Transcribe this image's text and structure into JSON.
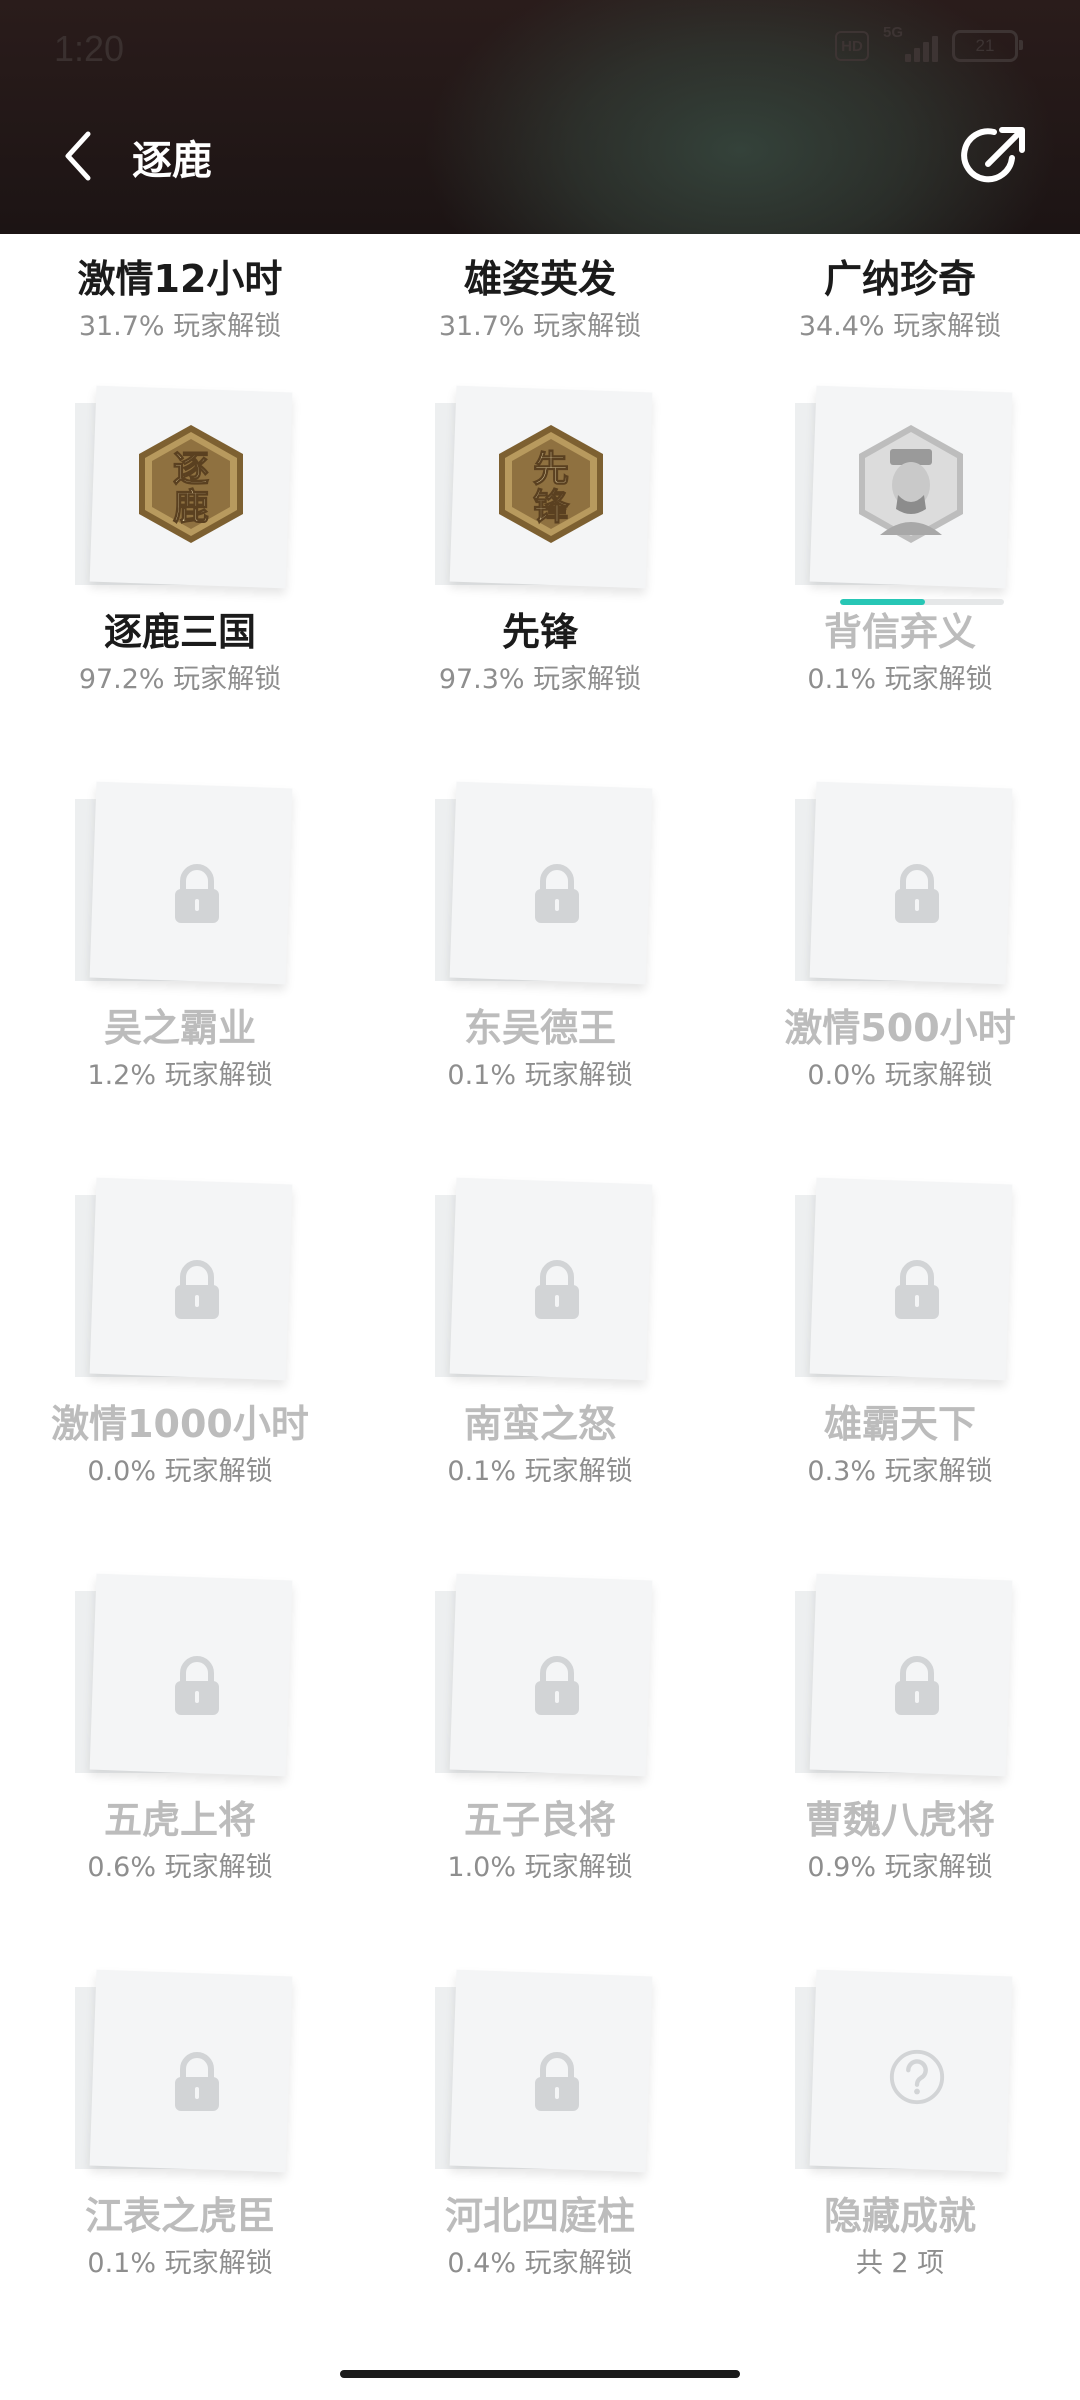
{
  "status_bar": {
    "time": "1:20",
    "network_badge": "HD",
    "network_type": "5G",
    "battery": "21"
  },
  "header": {
    "title": "逐鹿",
    "back_icon": "chevron-left-icon",
    "share_icon": "share-icon"
  },
  "colors": {
    "progress": "#27c6b5",
    "header_bg": "#1c1414",
    "locked_text": "#bcbcbc"
  },
  "achievements": [
    {
      "name": "激情12小时",
      "stat": "31.7% 玩家解锁",
      "state": "unlocked"
    },
    {
      "name": "雄姿英发",
      "stat": "31.7% 玩家解锁",
      "state": "unlocked"
    },
    {
      "name": "广纳珍奇",
      "stat": "34.4% 玩家解锁",
      "state": "unlocked"
    },
    {
      "name": "逐鹿三国",
      "stat": "97.2% 玩家解锁",
      "state": "unlocked",
      "badge": "逐鹿"
    },
    {
      "name": "先锋",
      "stat": "97.3% 玩家解锁",
      "state": "unlocked",
      "badge": "先锋"
    },
    {
      "name": "背信弃义",
      "stat": "0.1% 玩家解锁",
      "state": "in_progress",
      "progress": 0.52
    },
    {
      "name": "吴之霸业",
      "stat": "1.2% 玩家解锁",
      "state": "locked"
    },
    {
      "name": "东吴德王",
      "stat": "0.1% 玩家解锁",
      "state": "locked"
    },
    {
      "name": "激情500小时",
      "stat": "0.0% 玩家解锁",
      "state": "locked"
    },
    {
      "name": "激情1000小时",
      "stat": "0.0% 玩家解锁",
      "state": "locked"
    },
    {
      "name": "南蛮之怒",
      "stat": "0.1% 玩家解锁",
      "state": "locked"
    },
    {
      "name": "雄霸天下",
      "stat": "0.3% 玩家解锁",
      "state": "locked"
    },
    {
      "name": "五虎上将",
      "stat": "0.6% 玩家解锁",
      "state": "locked"
    },
    {
      "name": "五子良将",
      "stat": "1.0% 玩家解锁",
      "state": "locked"
    },
    {
      "name": "曹魏八虎将",
      "stat": "0.9% 玩家解锁",
      "state": "locked"
    },
    {
      "name": "江表之虎臣",
      "stat": "0.1% 玩家解锁",
      "state": "locked"
    },
    {
      "name": "河北四庭柱",
      "stat": "0.4% 玩家解锁",
      "state": "locked"
    },
    {
      "name": "隐藏成就",
      "stat": "共 2 项",
      "state": "hidden"
    }
  ]
}
